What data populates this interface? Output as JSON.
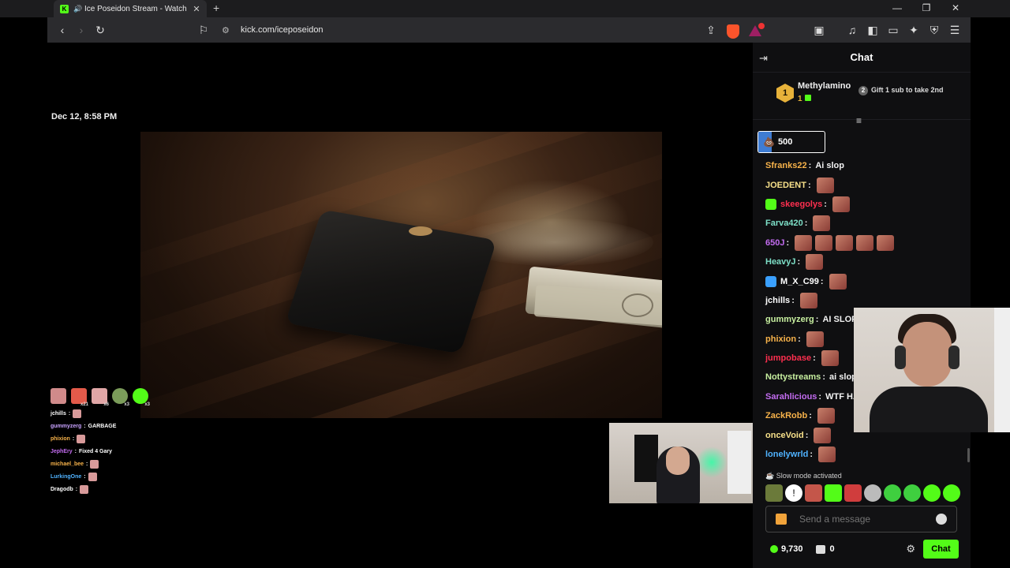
{
  "browser": {
    "tab_title": "Ice Poseidon Stream - Watch",
    "url": "kick.com/iceposeidon",
    "favicon_letter": "K"
  },
  "stream": {
    "timestamp": "Dec 12, 8:58 PM",
    "overlay_emote_counts": [
      "x21",
      "x6",
      "x3",
      "x3"
    ],
    "overlay_chat": [
      {
        "user": "jchills",
        "text": "",
        "color": "#ffffff",
        "emote": true
      },
      {
        "user": "gummyzerg",
        "text": "GARBAGE",
        "color": "#c8a2ff",
        "emote": false
      },
      {
        "user": "phixion",
        "text": "",
        "color": "#f7b24a",
        "emote": true
      },
      {
        "user": "JephEry",
        "text": "Fixed 4 Gary",
        "color": "#c36cf0",
        "emote": false
      },
      {
        "user": "michael_bee",
        "text": "",
        "color": "#f7b24a",
        "emote": true
      },
      {
        "user": "LurkingOne",
        "text": "",
        "color": "#4fb2ff",
        "emote": true
      },
      {
        "user": "Dragodb",
        "text": "",
        "color": "#ffffff",
        "emote": true
      }
    ]
  },
  "chat": {
    "title": "Chat",
    "leaderboard": {
      "rank": "1",
      "name": "Methylamino",
      "subs": "1",
      "gift_num": "2",
      "gift_text": "Gift 1 sub to take 2nd"
    },
    "pinned": {
      "amount": "500",
      "progress_fraction": 0.2
    },
    "messages": [
      {
        "user": "Sfranks22",
        "color": "#f7b24a",
        "text": "Ai slop",
        "emotes": 0,
        "badge": ""
      },
      {
        "user": "JOEDENT",
        "color": "#f7e08a",
        "text": "",
        "emotes": 1,
        "badge": ""
      },
      {
        "user": "skeegolys",
        "color": "#ff2f4f",
        "text": "",
        "emotes": 1,
        "badge": "#53fc18"
      },
      {
        "user": "Farva420",
        "color": "#7ee0c8",
        "text": "",
        "emotes": 1,
        "badge": ""
      },
      {
        "user": "650J",
        "color": "#c36cf0",
        "text": "",
        "emotes": 5,
        "badge": ""
      },
      {
        "user": "HeavyJ",
        "color": "#7ee0c8",
        "text": "",
        "emotes": 1,
        "badge": ""
      },
      {
        "user": "M_X_C99",
        "color": "#ffffff",
        "text": "",
        "emotes": 1,
        "badge": "#3aa0ff"
      },
      {
        "user": "jchills",
        "color": "#ffffff",
        "text": "",
        "emotes": 1,
        "badge": ""
      },
      {
        "user": "gummyzerg",
        "color": "#c8f0a0",
        "text": "AI SLOP",
        "emotes": 0,
        "badge": ""
      },
      {
        "user": "phixion",
        "color": "#f7b24a",
        "text": "",
        "emotes": 1,
        "badge": ""
      },
      {
        "user": "jumpobase",
        "color": "#ff2f4f",
        "text": "",
        "emotes": 1,
        "badge": ""
      },
      {
        "user": "Nottystreams",
        "color": "#c8f0a0",
        "text": "ai slop",
        "emotes": 0,
        "badge": ""
      },
      {
        "user": "Sarahlicious",
        "color": "#c36cf0",
        "text": "WTF HA",
        "emotes": 0,
        "badge": ""
      },
      {
        "user": "ZackRobb",
        "color": "#f7b24a",
        "text": "",
        "emotes": 1,
        "badge": ""
      },
      {
        "user": "onceVoid",
        "color": "#f7e08a",
        "text": "",
        "emotes": 1,
        "badge": ""
      },
      {
        "user": "lonelywrld",
        "color": "#4fb2ff",
        "text": "",
        "emotes": 1,
        "badge": ""
      }
    ],
    "slow_mode": "Slow mode activated",
    "input_placeholder": "Send a message",
    "points": "9,730",
    "shop_count": "0",
    "send_label": "Chat"
  },
  "colors": {
    "kick_green": "#53fc18",
    "chat_bg": "#0f0f11",
    "pin_blue": "#3e7cd3"
  }
}
